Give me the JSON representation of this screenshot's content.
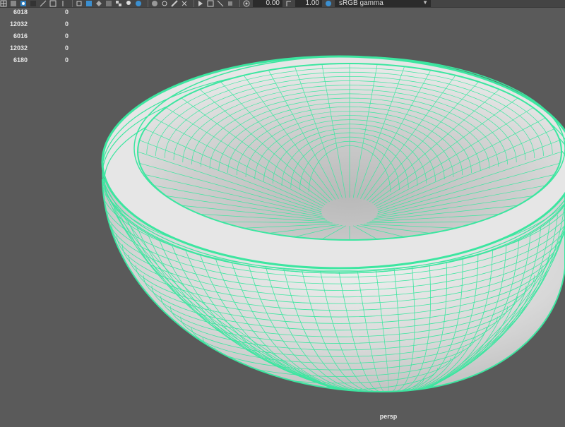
{
  "toolbar": {
    "exposure_value": "0.00",
    "gamma_value": "1.00",
    "color_space": "sRGB gamma"
  },
  "hud": {
    "rows": [
      {
        "value": "6018",
        "selected": "0"
      },
      {
        "value": "12032",
        "selected": "0"
      },
      {
        "value": "6016",
        "selected": "0"
      },
      {
        "value": "12032",
        "selected": "0"
      },
      {
        "value": "6180",
        "selected": "0"
      }
    ]
  },
  "viewport": {
    "camera_label": "persp",
    "object": "bowl-mesh",
    "wireframe_color": "#3ce6a0",
    "background_color": "#5a5a5a"
  }
}
